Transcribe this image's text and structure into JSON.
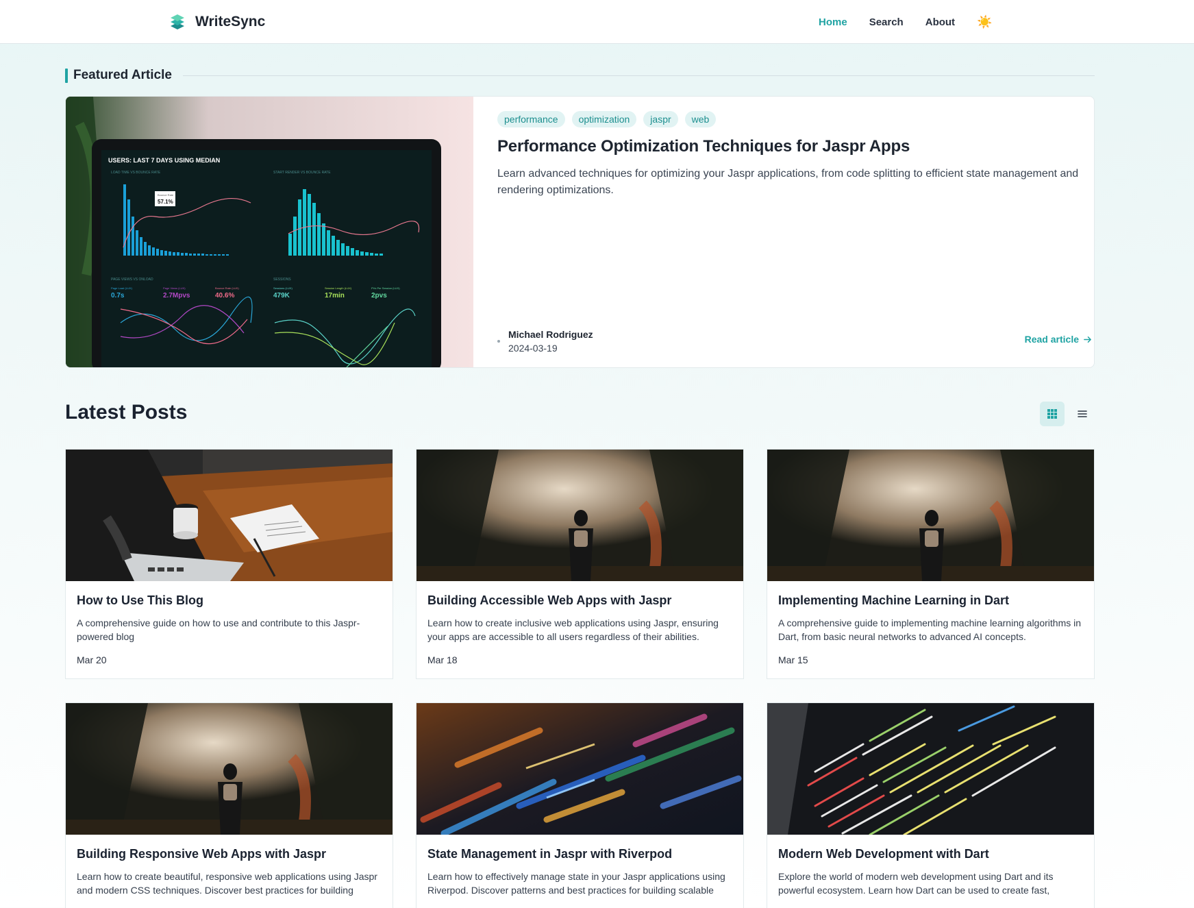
{
  "header": {
    "brand_name": "WriteSync",
    "nav": {
      "home": "Home",
      "search": "Search",
      "about": "About",
      "theme_icon": "☀️"
    }
  },
  "featured": {
    "section_title": "Featured Article",
    "tags": [
      "performance",
      "optimization",
      "jaspr",
      "web"
    ],
    "title": "Performance Optimization Techniques for Jaspr Apps",
    "excerpt": "Learn advanced techniques for optimizing your Jaspr applications, from code splitting to efficient state management and rendering optimizations.",
    "author": "Michael Rodriguez",
    "date": "2024-03-19",
    "read_label": "Read article",
    "image_text": {
      "header": "USERS: LAST 7 DAYS USING MEDIAN",
      "panel_a": "LOAD TIME VS BOUNCE RATE",
      "panel_b": "START RENDER VS BOUNCE RATE",
      "options": "OPTIONS",
      "tooltip_label": "Bounce Rate",
      "tooltip": "57.1%",
      "panel_c": "PAGE VIEWS VS ONLOAD",
      "panel_d": "SESSIONS",
      "metric_a_label": "Page Load (LUX)",
      "metric_a": "0.7s",
      "metric_b_label": "Page Views (LUX)",
      "metric_b": "2.7Mpvs",
      "metric_c_label": "Bounce Rate (LUX)",
      "metric_c": "40.6%",
      "metric_d_label": "Sessions (LUX)",
      "metric_d": "479K",
      "metric_e_label": "Session Length (LUX)",
      "metric_e": "17min",
      "metric_f_label": "PVs Per Session (LUX)",
      "metric_f": "2pvs"
    }
  },
  "latest": {
    "title": "Latest Posts",
    "posts": [
      {
        "title": "How to Use This Blog",
        "excerpt": "A comprehensive guide on how to use and contribute to this Jaspr-powered blog",
        "date": "Mar 20",
        "image": "desk"
      },
      {
        "title": "Building Accessible Web Apps with Jaspr",
        "excerpt": "Learn how to create inclusive web applications using Jaspr, ensuring your apps are accessible to all users regardless of their abilities.",
        "date": "Mar 18",
        "image": "forest"
      },
      {
        "title": "Implementing Machine Learning in Dart",
        "excerpt": "A comprehensive guide to implementing machine learning algorithms in Dart, from basic neural networks to advanced AI concepts.",
        "date": "Mar 15",
        "image": "forest"
      },
      {
        "title": "Building Responsive Web Apps with Jaspr",
        "excerpt": "Learn how to create beautiful, responsive web applications using Jaspr and modern CSS techniques. Discover best practices for building layouts that work seamlessly across all devices.",
        "date": "",
        "image": "forest"
      },
      {
        "title": "State Management in Jaspr with Riverpod",
        "excerpt": "Learn how to effectively manage state in your Jaspr applications using Riverpod. Discover patterns and best practices for building scalable and maintainable web applications.",
        "date": "",
        "image": "code-blur"
      },
      {
        "title": "Modern Web Development with Dart",
        "excerpt": "Explore the world of modern web development using Dart and its powerful ecosystem. Learn how Dart can be used to create fast, scalable, and maintainable web applications.",
        "date": "",
        "image": "code-screen"
      }
    ]
  },
  "colors": {
    "accent": "#1fa3a3",
    "tag_bg": "#e1f3f3",
    "page_bg": "#e8f5f5"
  }
}
